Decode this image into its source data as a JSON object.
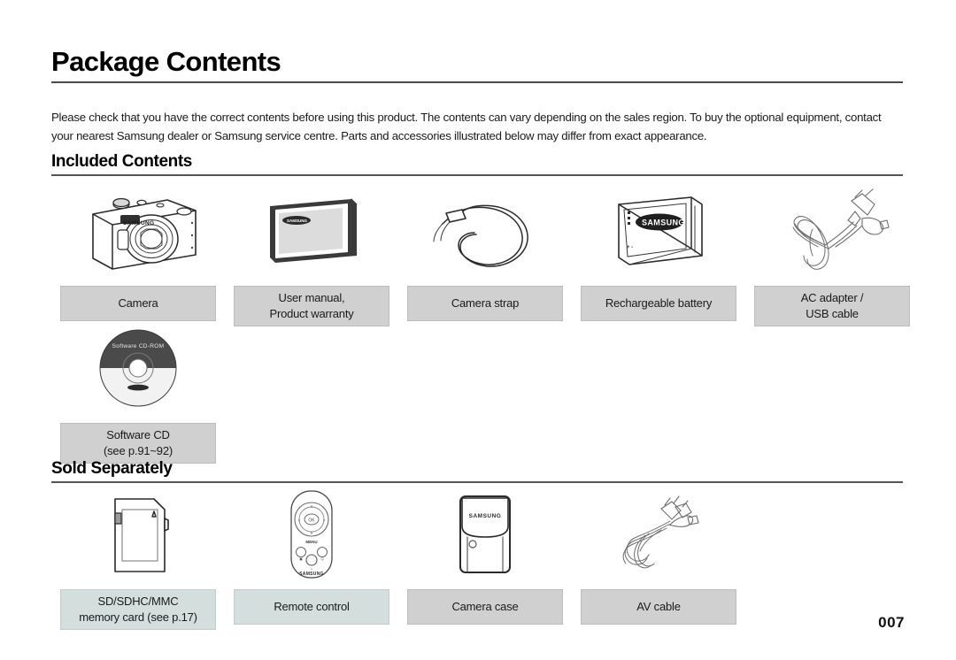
{
  "document": {
    "title": "Package Contents",
    "intro": "Please check that you have the correct contents before using this product. The contents can vary depending on the sales region. To buy the optional equipment, contact your nearest Samsung dealer or Samsung service centre. Parts and accessories illustrated below may differ from exact appearance.",
    "page_number": "007"
  },
  "sections": [
    {
      "heading": "Included Contents"
    },
    {
      "heading": "Sold Separately"
    }
  ],
  "included_row1": [
    {
      "icon": "camera-icon",
      "caption_line1": "Camera",
      "caption_line2": ""
    },
    {
      "icon": "user-manual-icon",
      "caption_line1": "User manual,",
      "caption_line2": "Product warranty"
    },
    {
      "icon": "camera-strap-icon",
      "caption_line1": "Camera strap",
      "caption_line2": ""
    },
    {
      "icon": "battery-icon",
      "caption_line1": "Rechargeable battery",
      "caption_line2": ""
    },
    {
      "icon": "ac-adapter-usb-icon",
      "caption_line1": "AC adapter /",
      "caption_line2": "USB cable"
    }
  ],
  "included_row2": [
    {
      "icon": "software-cd-icon",
      "caption_line1": "Software CD",
      "caption_line2": "(see p.91~92)",
      "disc_label": "Software CD-ROM"
    }
  ],
  "sold_separately": [
    {
      "icon": "memory-card-icon",
      "caption_line1": "SD/SDHC/MMC",
      "caption_line2": "memory card (see p.17)",
      "tinted": true
    },
    {
      "icon": "remote-control-icon",
      "caption_line1": "Remote control",
      "caption_line2": "",
      "tinted": true,
      "brand": "SAMSUNG"
    },
    {
      "icon": "camera-case-icon",
      "caption_line1": "Camera case",
      "caption_line2": "",
      "tinted": false,
      "brand": "SAMSUNG"
    },
    {
      "icon": "av-cable-icon",
      "caption_line1": "AV cable",
      "caption_line2": "",
      "tinted": false
    }
  ],
  "brands": {
    "camera": "SAMSUNG",
    "battery": "SAMSUNG",
    "manual": "SAMSUNG"
  },
  "colors": {
    "caption_gray": "#d0d0d0",
    "caption_tinted": "#d3dedd",
    "rule": "#4b4b4b",
    "text": "#1a1a1a"
  }
}
